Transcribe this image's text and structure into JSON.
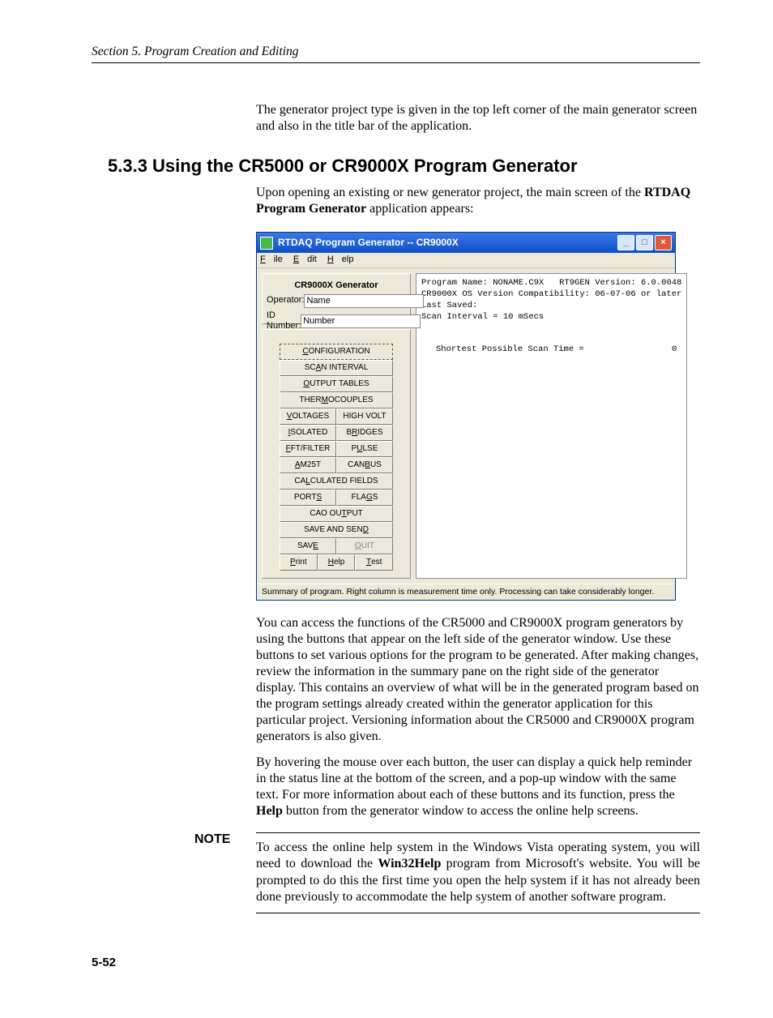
{
  "header": {
    "section_title": "Section 5.  Program Creation and Editing"
  },
  "intro": "The generator project type is given in the top left corner of the main generator screen and also in the title bar of the application.",
  "heading": "5.3.3  Using the CR5000 or CR9000X Program Generator",
  "opening": {
    "line1": "Upon opening an existing or new generator project, the main screen of the ",
    "bold": "RTDAQ Program Generator",
    "line2": " application appears:"
  },
  "win": {
    "title": "RTDAQ Program Generator -- CR9000X",
    "menu": {
      "file": "File",
      "edit": "Edit",
      "help": "Help"
    },
    "left": {
      "title": "CR9000X Generator",
      "operator_label": "Operator:",
      "operator_value": "Name",
      "id_label": "ID Number:",
      "id_value": "Number"
    },
    "buttons": {
      "configuration": "CONFIGURATION",
      "scan_interval": "SCAN INTERVAL",
      "output_tables": "OUTPUT TABLES",
      "thermocouples": "THERMOCOUPLES",
      "voltages": "VOLTAGES",
      "high_volt": "HIGH VOLT",
      "isolated": "ISOLATED",
      "bridges": "BRIDGES",
      "fft_filter": "FFT/FILTER",
      "pulse": "PULSE",
      "am25t": "AM25T",
      "canbus": "CANBUS",
      "calculated": "CALCULATED FIELDS",
      "ports": "PORTS",
      "flags": "FLAGS",
      "cao_output": "CAO OUTPUT",
      "save_send": "SAVE AND SEND",
      "save": "SAVE",
      "quit": "QUIT",
      "print": "Print",
      "help": "Help",
      "test": "Test"
    },
    "right": {
      "l1": "Program Name: NONAME.C9X   RT9GEN Version: 6.0.0048",
      "l2": "CR9000X OS Version Compatibility: 06-07-06 or later",
      "l3": "Last Saved:",
      "l4": "Scan Interval = 10 mSecs",
      "shortest_label": "Shortest Possible Scan Time =",
      "shortest_value": "0"
    },
    "status": "Summary of program. Right column is measurement time only. Processing can take considerably longer."
  },
  "para1": "You can access the functions of the CR5000 and CR9000X program generators by using the buttons that appear on the left side of the generator window.  Use these buttons to set various options for the program to be generated.  After making changes, review the information in the summary pane on the right side of the generator display.  This contains an overview of what will be in the generated program based on the program settings already created within the generator application for this particular project.  Versioning information about the CR5000 and CR9000X program generators is also given.",
  "para2a": "By hovering the mouse over each button, the user can display a quick help reminder in the status line at the bottom of the screen, and a pop-up window with the same text.  For more information about each of these buttons and its function, press the ",
  "para2_bold": "Help",
  "para2b": " button from the generator window to access the online help screens.",
  "note": {
    "label": "NOTE",
    "text_a": "To access the online help system in the Windows Vista operating system, you will need to download the ",
    "bold": "Win32Help",
    "text_b": " program from Microsoft's website.  You will be prompted to do this the first time you open the help system if it has not already been done previously to accommodate the help system of another software program."
  },
  "page_number": "5-52"
}
